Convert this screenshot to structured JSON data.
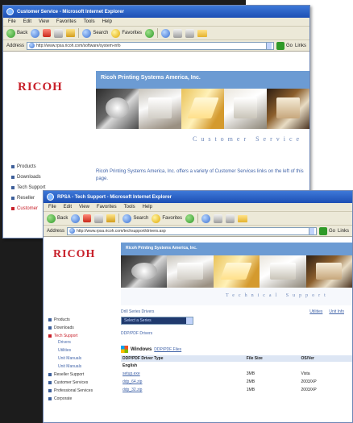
{
  "window1": {
    "title": "Customer Service - Microsoft Internet Explorer",
    "menu": [
      "File",
      "Edit",
      "View",
      "Favorites",
      "Tools",
      "Help"
    ],
    "toolbar": {
      "back": "Back",
      "search": "Search",
      "favorites": "Favorites"
    },
    "address": {
      "label": "Address",
      "url": "http://www.rpsa.ricoh.com/software/system-info",
      "go": "Go",
      "links": "Links"
    },
    "logo": "RICOH",
    "banner": "Ricoh Printing Systems America, Inc.",
    "band_title": "Customer Service",
    "nav": [
      "Products",
      "Downloads",
      "Tech Support",
      "Reseller",
      "Customer"
    ],
    "intro": "Ricoh Printing Systems America, Inc. offers a variety of Customer Services links on the left of this page."
  },
  "window2": {
    "title": "RPSA - Tech Support - Microsoft Internet Explorer",
    "menu": [
      "File",
      "Edit",
      "View",
      "Favorites",
      "Tools",
      "Help"
    ],
    "toolbar": {
      "back": "Back",
      "search": "Search",
      "favorites": "Favorites"
    },
    "address": {
      "label": "Address",
      "url": "http://www.rpsa.ricoh.com/techsupport/drivers.asp",
      "go": "Go",
      "links": "Links"
    },
    "logo": "RICOH",
    "banner": "Ricoh Printing Systems America, Inc.",
    "band_title": "Technical Support",
    "nav": [
      "Products",
      "Downloads",
      "Tech Support",
      "Reseller Support",
      "Customer Services",
      "Professional Services",
      "Corporate"
    ],
    "subnav": [
      "Drivers",
      "Utilities",
      "Unit Manuals",
      "Unit Manuals"
    ],
    "series_label": "Drill Series Drivers",
    "series_value": "Select a Series",
    "header_links": [
      "Utilities",
      "Unit Info"
    ],
    "src_link": "DDP/PDF Drivers",
    "os_heading": "Windows",
    "os_link": "DDP/PDF Files",
    "table": {
      "headers": [
        "DDP/PDF Driver Type",
        "File Size",
        "OS/Ver"
      ],
      "group": "English",
      "rows": [
        [
          "setup.exe",
          "3MB",
          "Vista"
        ],
        [
          "ddp_64.zip",
          "2MB",
          "2003/XP"
        ],
        [
          "ddp_32.zip",
          "1MB",
          "2003/XP"
        ]
      ]
    }
  },
  "colors": {
    "title_bar": "#2a5fc4",
    "banner": "#6c9bd3",
    "logo": "#c8202a",
    "link": "#4063a8"
  }
}
